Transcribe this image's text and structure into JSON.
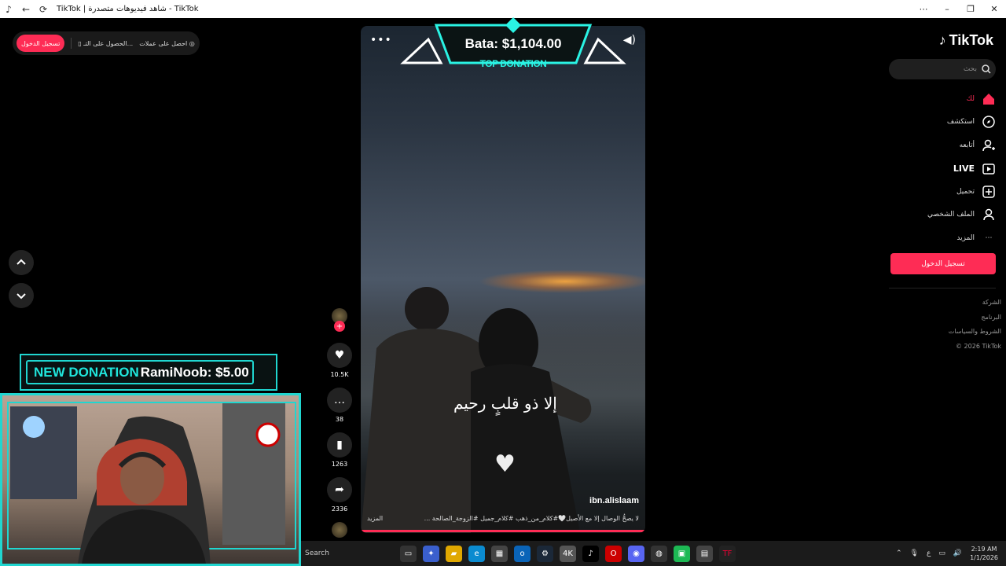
{
  "window": {
    "title": "TikTok | شاهد فيديوهات متصدرة - TikTok",
    "controls": {
      "minimize": "–",
      "restore": "❐",
      "close": "✕"
    }
  },
  "header_pill": {
    "login_label": "تسجيل الدخول",
    "get_app_label": "الحصول على التـ...",
    "get_coins_label": "احصل على عملات"
  },
  "sidebar": {
    "logo_text": "TikTok",
    "search_placeholder": "بحث",
    "nav": [
      {
        "label": "لك",
        "icon": "home-icon",
        "active": true
      },
      {
        "label": "استكشف",
        "icon": "compass-icon"
      },
      {
        "label": "أتابعه",
        "icon": "following-icon"
      },
      {
        "label": "LIVE",
        "icon": "live-icon"
      },
      {
        "label": "تحميل",
        "icon": "upload-icon"
      },
      {
        "label": "الملف الشخصي",
        "icon": "profile-icon"
      },
      {
        "label": "المزيد",
        "icon": "more-icon"
      }
    ],
    "login_button": "تسجيل الدخول",
    "footer": [
      "الشركة",
      "البرنامج",
      "الشروط والسياسات",
      "© 2026 TikTok"
    ]
  },
  "video": {
    "author": "ibn.alislaam",
    "overlay_text": "إلا ذو قلبٍ رحيم",
    "caption": "لا يصحُّ الوصال إلا مع الأصيل🤍#كلام_من_ذهب #كلام_جميل #الزوجة_الصالحة ...",
    "more_label": "المزيد"
  },
  "actions": {
    "likes": "10.5K",
    "comments": "38",
    "saves": "1263",
    "shares": "2336"
  },
  "stream_overlay": {
    "top_donation_amount": "Bata: $1,104.00",
    "top_donation_label": "TOP DONATION",
    "new_donation_label": "NEW DONATION",
    "new_donation_text": "RamiNoob: $5.00"
  },
  "taskbar": {
    "search_label": "Search",
    "time": "2:19 AM",
    "date": "1/1/2026",
    "lang": "ع"
  },
  "colors": {
    "accent": "#fe2c55",
    "overlay": "#20d6d0"
  }
}
